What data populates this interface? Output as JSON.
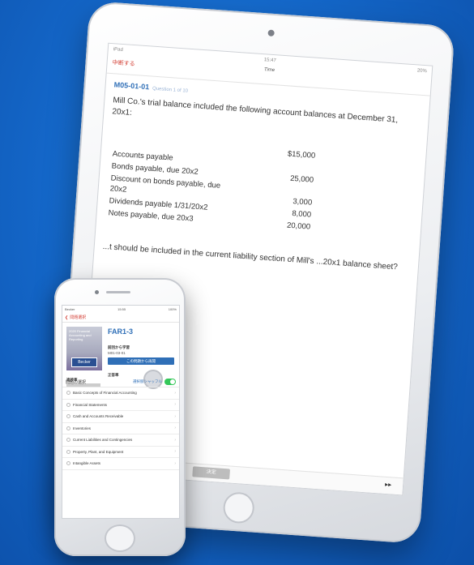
{
  "ipad": {
    "status_left": "iPad",
    "status_time": "15:47",
    "status_right": "20%",
    "suspend_label": "中断する",
    "time_label": "Time",
    "question_id": "M05-01-01",
    "question_sub": "Question 1 of 10",
    "question_text": "Mill Co.'s trial balance included the following account balances at December 31, 20x1:",
    "accounts": [
      {
        "name": "",
        "amount": "$15,000"
      },
      {
        "name": "Accounts payable",
        "amount": ""
      },
      {
        "name": "Bonds payable, due 20x2",
        "amount": "25,000"
      },
      {
        "name": "Discount on bonds payable, due 20x2",
        "amount": "3,000"
      },
      {
        "name": "Dividends payable 1/31/20x2",
        "amount": "8,000"
      },
      {
        "name": "Notes payable, due 20x3",
        "amount": "20,000"
      }
    ],
    "question2": "...t should be included in the current liability section of Mill's ...20x1 balance sheet?",
    "decide_label": "決定",
    "next_icon": "▸▸"
  },
  "iphone": {
    "status_left": "Becker",
    "status_time": "15:55",
    "status_right": "100%",
    "back_label": "問題選択",
    "cover_text": "2020 Financial Accounting and Reporting",
    "cover_brand": "Becker",
    "code": "FAR1-3",
    "resume_label": "前回から学習",
    "resume_id": "M01-03-01",
    "start_button": "この問題から再開",
    "progress_label": "進捗率",
    "rate_label": "正答率",
    "select_label": "問題の選択",
    "shuffle_label": "選択肢シャッフル",
    "shuffle_on": true,
    "topics": [
      "Basic Concepts of Financial Accounting",
      "Financial Statements",
      "Cash and Accounts Receivable",
      "Inventories",
      "Current Liabilities and Contingencies",
      "Property, Plant, and Equipment",
      "Intangible Assets"
    ]
  },
  "colors": {
    "background": "#1467c9",
    "accent": "#2f6fb7",
    "alert": "#d23a2f",
    "toggle": "#34c759"
  }
}
